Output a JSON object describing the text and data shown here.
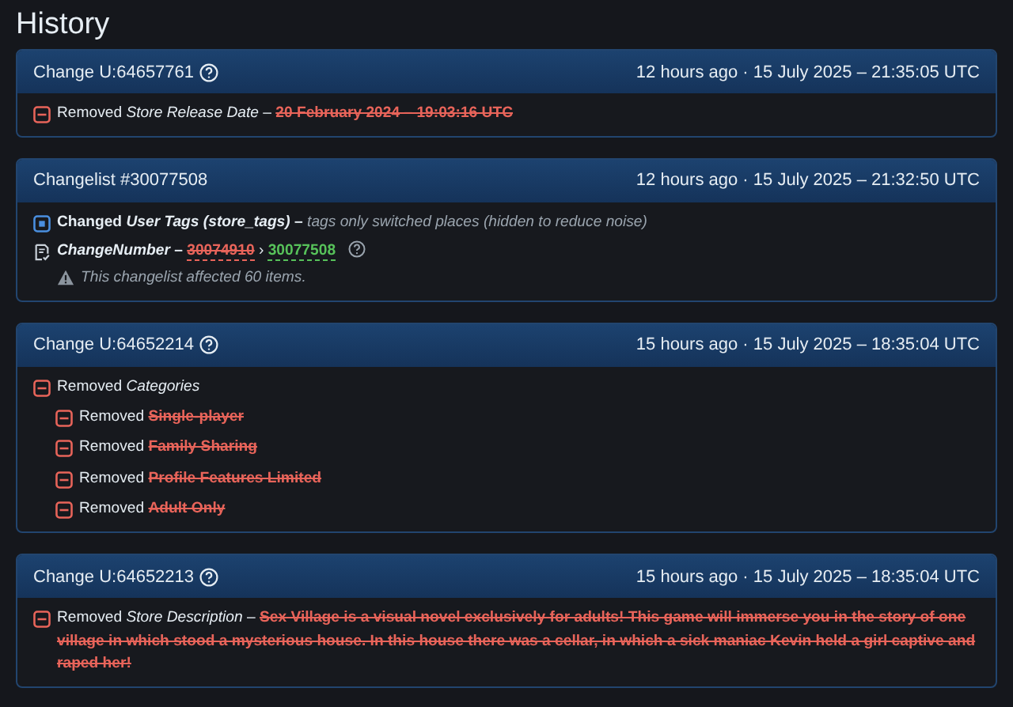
{
  "page_title": "History",
  "changes": [
    {
      "title": "Change U:64657761",
      "help": true,
      "time": "12 hours ago · 15 July 2025 – 21:35:05 UTC",
      "entries": [
        {
          "kind": "removed",
          "verb": "Removed",
          "field": "Store Release Date",
          "sep": "–",
          "old": "20 February 2024 – 19:03:16 UTC"
        }
      ]
    },
    {
      "title": "Changelist #30077508",
      "help": false,
      "time": "12 hours ago · 15 July 2025 – 21:32:50 UTC",
      "entries": [
        {
          "kind": "changed",
          "verb": "Changed",
          "field": "User Tags (store_tags)",
          "sep": "–",
          "note": "tags only switched places (hidden to reduce noise)"
        },
        {
          "kind": "number",
          "field": "ChangeNumber",
          "sep": "–",
          "old": "30074910",
          "arrow": "›",
          "new": "30077508",
          "warning": "This changelist affected 60 items."
        }
      ]
    },
    {
      "title": "Change U:64652214",
      "help": true,
      "time": "15 hours ago · 15 July 2025 – 18:35:04 UTC",
      "entries": [
        {
          "kind": "removed",
          "verb": "Removed",
          "field": "Categories",
          "children": [
            {
              "verb": "Removed",
              "old": "Single-player"
            },
            {
              "verb": "Removed",
              "old": "Family Sharing"
            },
            {
              "verb": "Removed",
              "old": "Profile Features Limited"
            },
            {
              "verb": "Removed",
              "old": "Adult Only"
            }
          ]
        }
      ]
    },
    {
      "title": "Change U:64652213",
      "help": true,
      "time": "15 hours ago · 15 July 2025 – 18:35:04 UTC",
      "entries": [
        {
          "kind": "removed",
          "verb": "Removed",
          "field": "Store Description",
          "sep": "–",
          "old": "Sex Village is a visual novel exclusively for adults! This game will immerse you in the story of one village in which stood a mysterious house. In this house there was a cellar, in which a sick maniac Kevin held a girl captive and raped her!"
        }
      ]
    }
  ]
}
